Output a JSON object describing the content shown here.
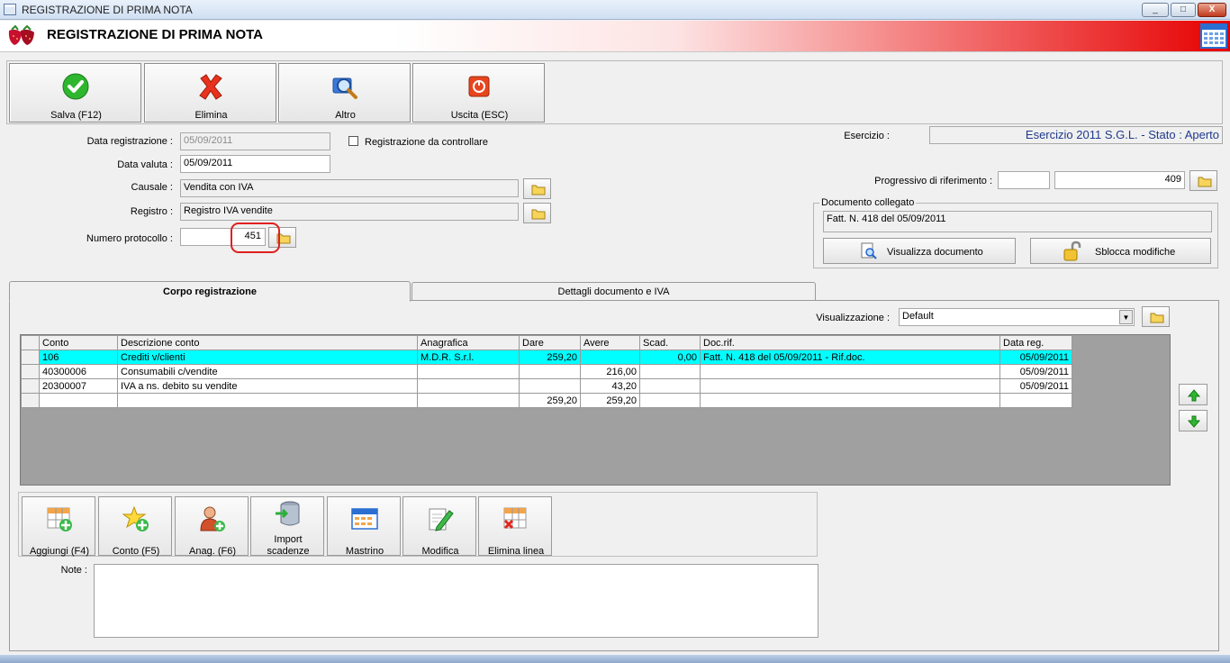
{
  "window": {
    "title": "REGISTRAZIONE DI PRIMA NOTA",
    "min": "_",
    "max": "□",
    "close": "X"
  },
  "header": {
    "title": "REGISTRAZIONE DI PRIMA NOTA"
  },
  "toolbar": {
    "save": "Salva (F12)",
    "delete": "Elimina",
    "other": "Altro",
    "exit": "Uscita (ESC)"
  },
  "form": {
    "data_registrazione_label": "Data registrazione :",
    "data_registrazione": "05/09/2011",
    "da_controllare_label": "Registrazione da controllare",
    "data_valuta_label": "Data valuta :",
    "data_valuta": "05/09/2011",
    "causale_label": "Causale :",
    "causale": "Vendita con IVA",
    "registro_label": "Registro :",
    "registro": "Registro IVA vendite",
    "protocollo_label": "Numero protocollo :",
    "protocollo": "451",
    "esercizio_label": "Esercizio :",
    "esercizio": "Esercizio 2011 S.G.L. - Stato : Aperto",
    "progressivo_label": "Progressivo di riferimento :",
    "progressivo_a": "",
    "progressivo_b": "409"
  },
  "documento": {
    "legend": "Documento collegato",
    "value": "Fatt. N. 418 del 05/09/2011",
    "view": "Visualizza documento",
    "unlock": "Sblocca modifiche"
  },
  "tabs": {
    "corpo": "Corpo registrazione",
    "dettagli": "Dettagli documento e IVA"
  },
  "view": {
    "label": "Visualizzazione :",
    "value": "Default"
  },
  "grid": {
    "headers": [
      "Conto",
      "Descrizione conto",
      "Anagrafica",
      "Dare",
      "Avere",
      "Scad.",
      "Doc.rif.",
      "Data reg."
    ],
    "rows": [
      [
        "106",
        "Crediti v/clienti",
        "M.D.R. S.r.l.",
        "259,20",
        "",
        "0,00",
        "Fatt. N. 418 del 05/09/2011 - Rif.doc.",
        "05/09/2011"
      ],
      [
        "40300006",
        "Consumabili c/vendite",
        "",
        "",
        "216,00",
        "",
        "",
        "05/09/2011"
      ],
      [
        "20300007",
        "IVA a ns. debito su vendite",
        "",
        "",
        "43,20",
        "",
        "",
        "05/09/2011"
      ],
      [
        "",
        "",
        "",
        "259,20",
        "259,20",
        "",
        "",
        ""
      ]
    ]
  },
  "tools": {
    "add": "Aggiungi (F4)",
    "conto": "Conto (F5)",
    "anag": "Anag. (F6)",
    "import_1": "Import",
    "import_2": "scadenze",
    "mastrino": "Mastrino",
    "modifica": "Modifica",
    "elimina_linea": "Elimina linea"
  },
  "note": {
    "label": "Note :",
    "value": ""
  },
  "colors": {
    "selected_row": "#00ffff",
    "esercizio_text": "#1f3a8a",
    "highlight": "#e02020"
  }
}
